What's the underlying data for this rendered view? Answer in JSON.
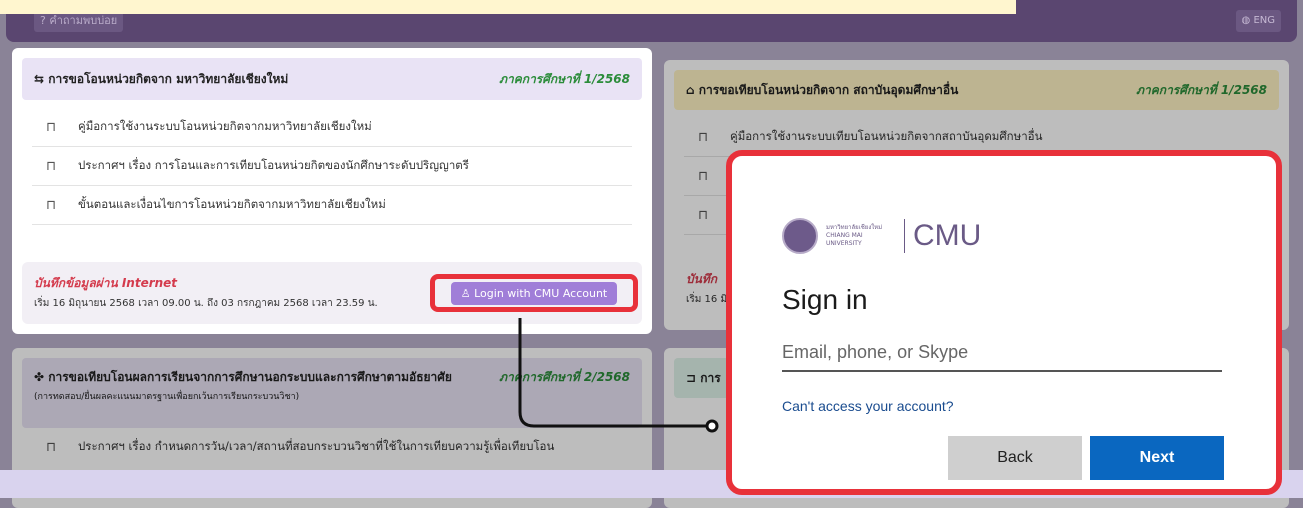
{
  "topbar": {
    "faq_label": "? คำถามพบบ่อย",
    "lang_label": "ENG"
  },
  "card1": {
    "title": "การขอโอนหน่วยกิตจาก มหาวิทยาลัยเชียงใหม่",
    "semester": "ภาคการศึกษาที่ 1/2568",
    "items": [
      "คู่มือการใช้งานระบบโอนหน่วยกิตจากมหาวิทยาลัยเชียงใหม่",
      "ประกาศฯ เรื่อง การโอนและการเทียบโอนหน่วยกิตของนักศึกษาระดับปริญญาตรี",
      "ขั้นตอนและเงื่อนไขการโอนหน่วยกิตจากมหาวิทยาลัยเชียงใหม่"
    ],
    "footer_title": "บันทึกข้อมูลผ่าน Internet",
    "footer_dates": "เริ่ม 16 มิถุนายน 2568 เวลา 09.00 น. ถึง 03 กรกฎาคม 2568 เวลา 23.59 น.",
    "login_label": "Login with CMU Account"
  },
  "card2": {
    "title": "การขอเทียบโอนหน่วยกิตจาก สถาบันอุดมศึกษาอื่น",
    "semester": "ภาคการศึกษาที่ 1/2568",
    "items": [
      "คู่มือการใช้งานระบบเทียบโอนหน่วยกิตจากสถาบันอุดมศึกษาอื่น"
    ],
    "footer_title": "บันทึก",
    "footer_dates": "เริ่ม 16 มิ"
  },
  "card3": {
    "title": "การขอเทียบโอนผลการเรียนจากการศึกษานอกระบบและการศึกษาตามอัธยาศัย",
    "subtitle": "(การทดสอบ/ยื่นผลคะแนนมาตรฐานเพื่อยกเว้นการเรียนกระบวนวิชา)",
    "semester": "ภาคการศึกษาที่ 2/2568",
    "items": [
      "ประกาศฯ เรื่อง กำหนดการวัน/เวลา/สถานที่สอบกระบวนวิชาที่ใช้ในการเทียบความรู้เพื่อเทียบโอน"
    ]
  },
  "card4": {
    "title": "การ"
  },
  "signin": {
    "university_name": "มหาวิทยาลัยเชียงใหม่ CHIANG MAI UNIVERSITY",
    "brand": "CMU",
    "heading": "Sign in",
    "email_placeholder": "Email, phone, or Skype",
    "cant_access": "Can't access your account?",
    "back_label": "Back",
    "next_label": "Next"
  },
  "colors": {
    "topbar": "#5a4670",
    "accent_red": "#e8313a",
    "login_purple": "#a07ed8",
    "next_blue": "#0a67c0",
    "semester_green": "#2b8c3a"
  }
}
